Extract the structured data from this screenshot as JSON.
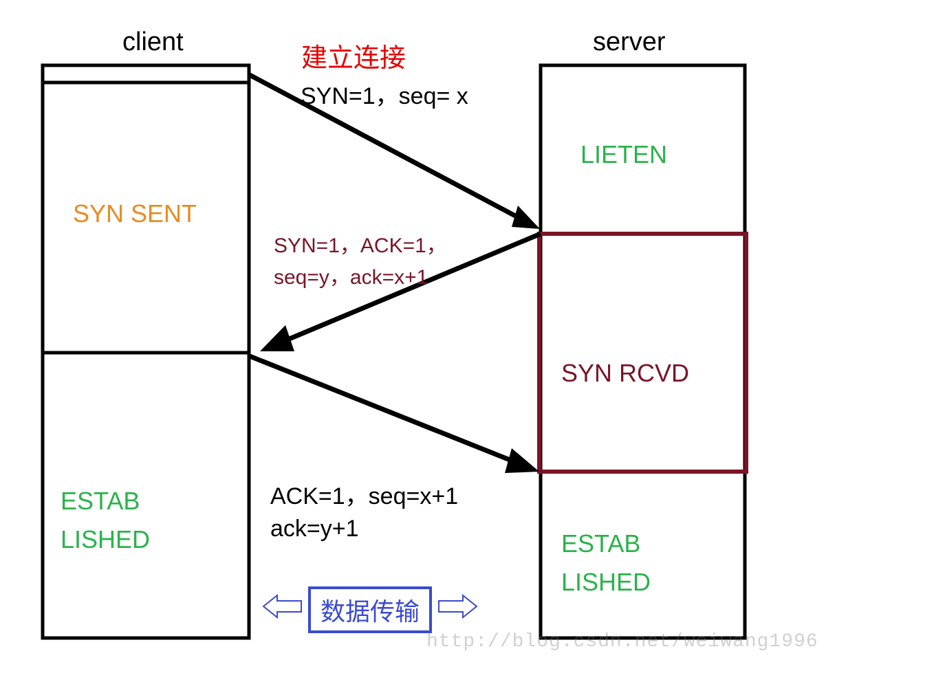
{
  "headers": {
    "client": "client",
    "server": "server"
  },
  "red_title": "建立连接",
  "client_states": {
    "syn_sent": "SYN SENT",
    "estab_1": "ESTAB",
    "estab_2": "LISHED"
  },
  "server_states": {
    "listen": "LIETEN",
    "syn_rcvd": "SYN RCVD",
    "estab_1": "ESTAB",
    "estab_2": "LISHED"
  },
  "messages": {
    "m1": "SYN=1，seq= x",
    "m2_line1": "SYN=1，ACK=1，",
    "m2_line2": "seq=y，ack=x+1",
    "m3_line1": "ACK=1，seq=x+1",
    "m3_line2": "ack=y+1"
  },
  "transfer_label": "数据传输",
  "watermark": "http://blog.csdn.net/weiwang1996"
}
